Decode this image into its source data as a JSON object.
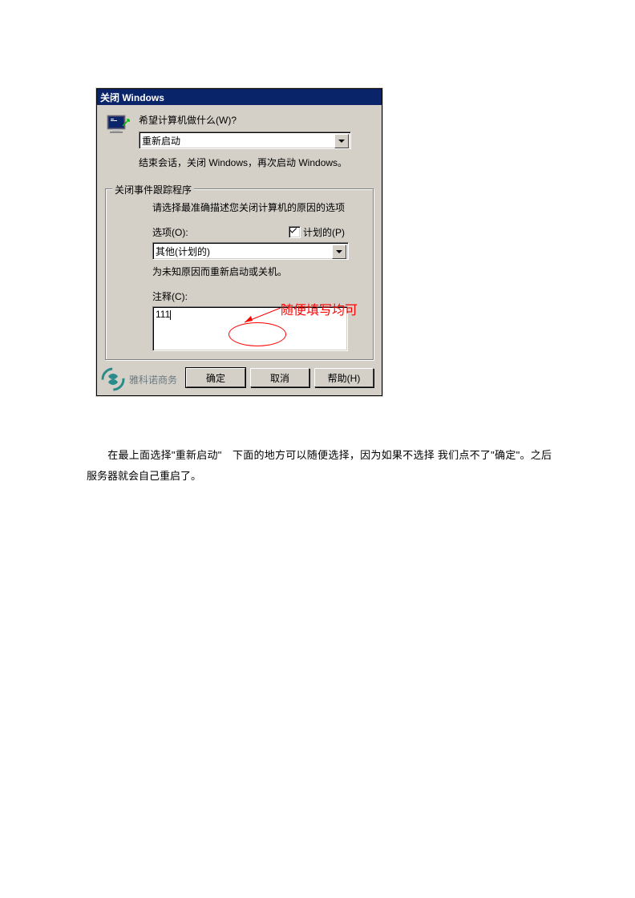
{
  "dialog": {
    "title": "关闭 Windows",
    "prompt_label": "希望计算机做什么(W)?",
    "action_selected": "重新启动",
    "action_desc": "结束会话，关闭 Windows，再次启动 Windows。",
    "groupbox_title": "关闭事件跟踪程序",
    "group_desc": "请选择最准确描述您关闭计算机的原因的选项",
    "options_label": "选项(O):",
    "planned_label": "计划的(P)",
    "planned_checked": true,
    "reason_selected": "其他(计划的)",
    "reason_desc": "为未知原因而重新启动或关机。",
    "comment_label": "注释(C):",
    "comment_value": "111",
    "buttons": {
      "ok": "确定",
      "cancel": "取消",
      "help": "帮助(H)"
    }
  },
  "annotation": {
    "text": "随便填写均可"
  },
  "watermark": {
    "text": "雅科诺商务"
  },
  "caption": {
    "text": "在最上面选择\"重新启动\"　下面的地方可以随便选择，因为如果不选择 我们点不了\"确定\"。之后服务器就会自己重启了。"
  }
}
